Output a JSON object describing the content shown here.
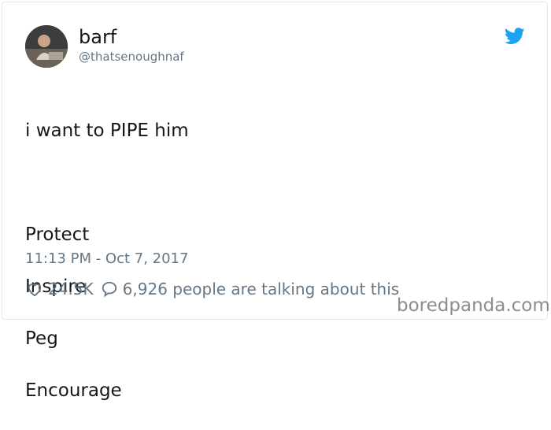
{
  "user": {
    "display_name": "barf",
    "handle": "@thatsenoughnaf",
    "avatar_icon": "profile-photo"
  },
  "tweet": {
    "lines": [
      "i want to PIPE him",
      "",
      "Protect",
      "Inspire",
      "Peg",
      "Encourage"
    ],
    "timestamp": "11:13 PM - Oct 7, 2017"
  },
  "engagement": {
    "likes": "24.5K",
    "talking": "6,926 people are talking about this",
    "like_icon": "heart-icon",
    "reply_icon": "speech-bubble-icon"
  },
  "brand": {
    "icon": "twitter-bird-icon",
    "color": "#1da1f2"
  },
  "watermark": "boredpanda.com"
}
